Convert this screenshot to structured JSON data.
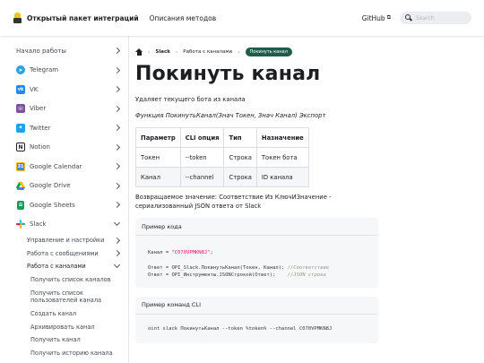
{
  "navbar": {
    "brand": "Открытый пакет интеграций",
    "methods_link": "Описания методов",
    "github": "GitHub",
    "search_placeholder": "Search"
  },
  "sidebar": {
    "items": [
      {
        "label": "Начало работы",
        "icon": "none",
        "color": "",
        "chevron": "right"
      },
      {
        "label": "Telegram",
        "icon": "telegram-icon",
        "color": "#2aa3df",
        "chevron": "right"
      },
      {
        "label": "VK",
        "icon": "vk-icon",
        "color": "#2787f5",
        "chevron": "right"
      },
      {
        "label": "Viber",
        "icon": "viber-icon",
        "color": "#7b519d",
        "chevron": "right"
      },
      {
        "label": "Twitter",
        "icon": "twitter-icon",
        "color": "#1da1f2",
        "chevron": "right"
      },
      {
        "label": "Notion",
        "icon": "notion-icon",
        "color": "#222222",
        "chevron": "right"
      },
      {
        "label": "Google Calendar",
        "icon": "google-calendar-icon",
        "color": "#4285f4",
        "chevron": "right"
      },
      {
        "label": "Google Drive",
        "icon": "google-drive-icon",
        "color": "#0f9d58",
        "chevron": "right"
      },
      {
        "label": "Google Sheets",
        "icon": "google-sheets-icon",
        "color": "#0f9d58",
        "chevron": "right"
      },
      {
        "label": "Slack",
        "icon": "slack-icon",
        "color": "#e01e5a",
        "chevron": "down"
      }
    ],
    "slack_sub": [
      {
        "label": "Управление и настройки",
        "chevron": "right",
        "active": false
      },
      {
        "label": "Работа с сообщениями",
        "chevron": "right",
        "active": false
      },
      {
        "label": "Работа с каналами",
        "chevron": "down",
        "active": true
      }
    ],
    "channel_methods": [
      "Получить список каналов",
      "Получить список пользователей канала",
      "Создать канал",
      "Архивировать канал",
      "Получить канал",
      "Получить историю канала"
    ]
  },
  "breadcrumbs": {
    "home": "home-icon",
    "items": [
      "Slack",
      "Работа с каналами"
    ],
    "active": "Покинуть канал"
  },
  "page": {
    "title": "Покинуть канал",
    "description": "Удаляет текущего бота из канала",
    "signature": "Функция ПокинутьКанал(Знач Токен, Знач Канал) Экспорт",
    "table": {
      "headers": [
        "Параметр",
        "CLI опция",
        "Тип",
        "Назначение"
      ],
      "rows": [
        [
          "Токен",
          "--token",
          "Строка",
          "Токен бота"
        ],
        [
          "Канал",
          "--channel",
          "Строка",
          "ID канала"
        ]
      ]
    },
    "returns": "Возвращаемое значение: Соответствие Из КлючИЗначение - сериализованный JSON ответа от Slack"
  },
  "code_example": {
    "title": "Пример кода",
    "line1_pre": "Канал = ",
    "line1_str": "\"C070VPMKN8J\"",
    "line1_post": ";",
    "line2_code": "Ответ = OPI_Slack.ПокинутьКанал(Токен, Канал); ",
    "line2_cmt": "//Соответствие",
    "line3_code": "Ответ = OPI_Инструменты.JSONСтрокой(Ответ);    ",
    "line3_cmt": "//JSON строка"
  },
  "cli_example": {
    "title": "Пример команд CLI",
    "command": "oint slack ПокинутьКанал --token %token% --channel C070VPMKN8J"
  }
}
